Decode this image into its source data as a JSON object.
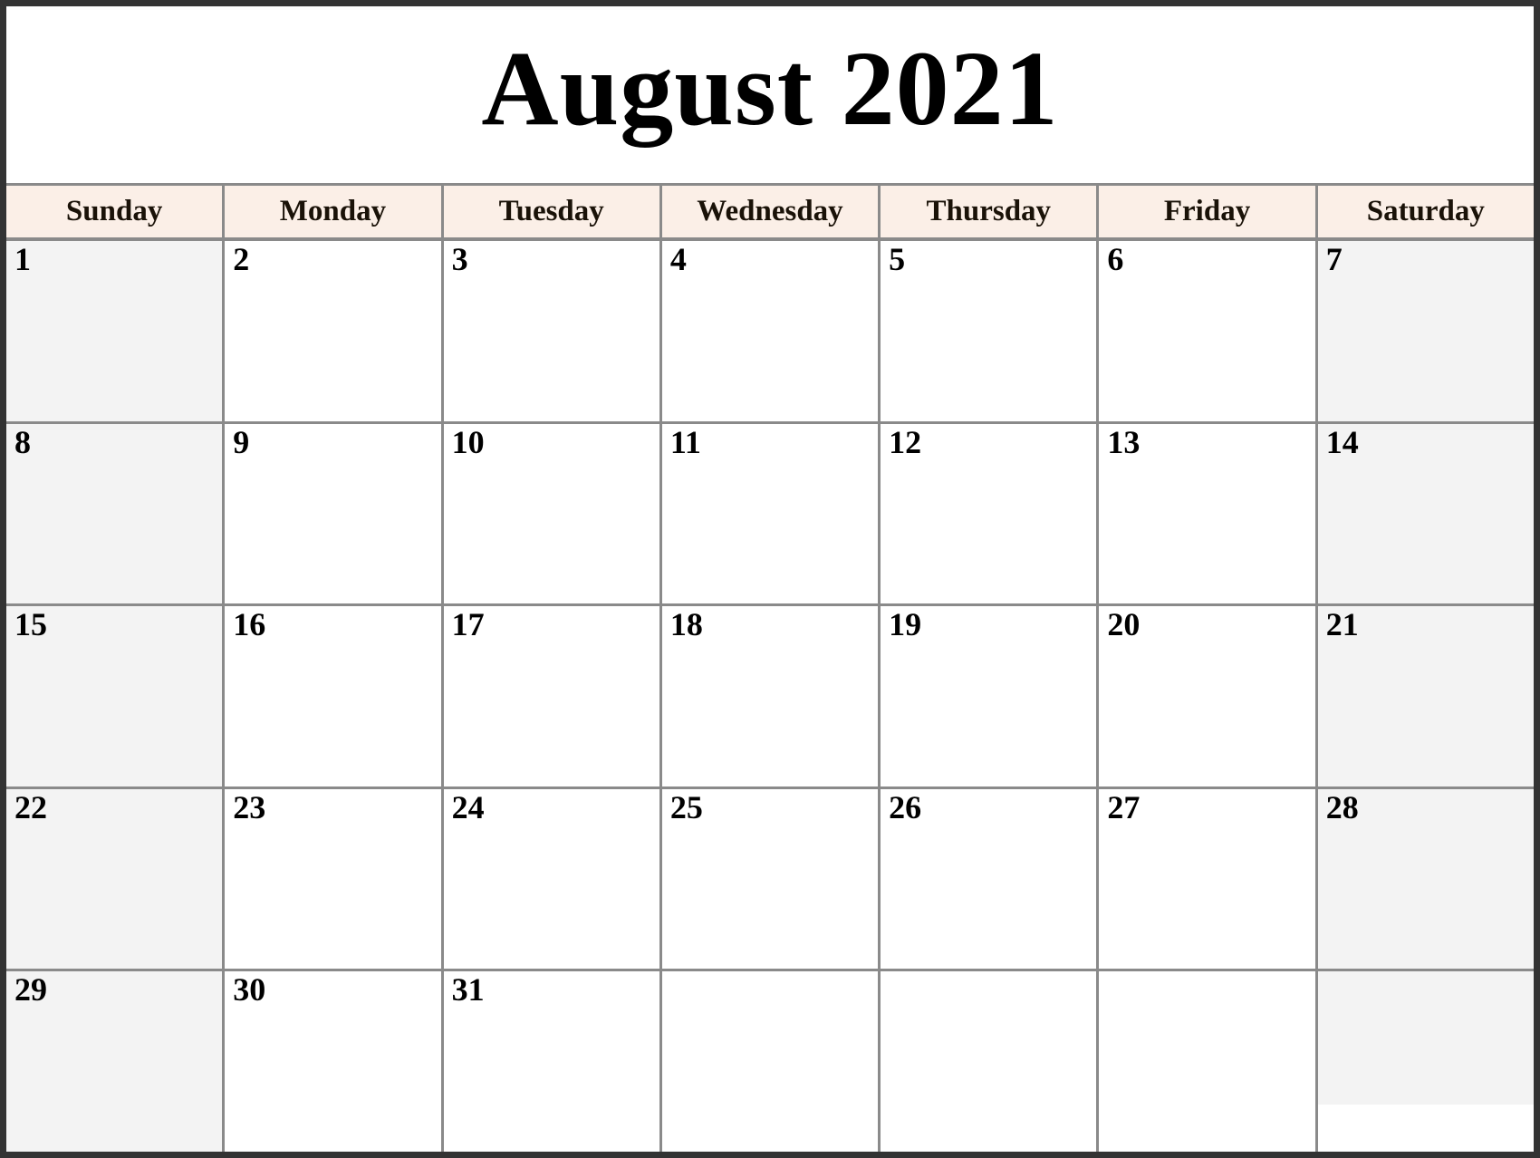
{
  "header": {
    "title": "August 2021",
    "month": "August",
    "year": "2021"
  },
  "weekdays": [
    {
      "label": "Sunday",
      "weekend": true
    },
    {
      "label": "Monday",
      "weekend": false
    },
    {
      "label": "Tuesday",
      "weekend": false
    },
    {
      "label": "Wednesday",
      "weekend": false
    },
    {
      "label": "Thursday",
      "weekend": false
    },
    {
      "label": "Friday",
      "weekend": false
    },
    {
      "label": "Saturday",
      "weekend": true
    }
  ],
  "weeks": [
    [
      "1",
      "2",
      "3",
      "4",
      "5",
      "6",
      "7"
    ],
    [
      "8",
      "9",
      "10",
      "11",
      "12",
      "13",
      "14"
    ],
    [
      "15",
      "16",
      "17",
      "18",
      "19",
      "20",
      "21"
    ],
    [
      "22",
      "23",
      "24",
      "25",
      "26",
      "27",
      "28"
    ],
    [
      "29",
      "30",
      "31",
      "",
      "",
      "",
      ""
    ]
  ],
  "colors": {
    "header_background": "#fbefe7",
    "weekend_cell": "#f3f3f3",
    "weekday_cell": "#ffffff",
    "grid_line": "#8a8a8a",
    "outer_frame": "#333333",
    "text": "#000000"
  }
}
